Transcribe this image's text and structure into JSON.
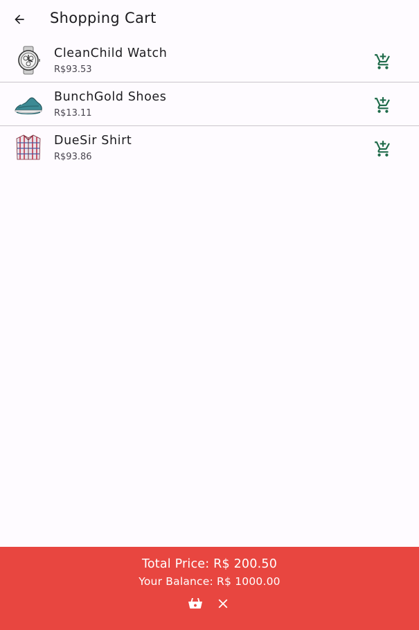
{
  "header": {
    "title": "Shopping Cart",
    "back_icon": "arrow-back-icon"
  },
  "cart": {
    "items": [
      {
        "name": "CleanChild Watch",
        "price": "R$93.53",
        "image": "watch-image",
        "action_icon": "add-shopping-cart-icon"
      },
      {
        "name": "BunchGold Shoes",
        "price": "R$13.11",
        "image": "shoes-image",
        "action_icon": "add-shopping-cart-icon"
      },
      {
        "name": "DueSir Shirt",
        "price": "R$93.86",
        "image": "shirt-image",
        "action_icon": "add-shopping-cart-icon"
      }
    ]
  },
  "footer": {
    "total_label": "Total Price: R$ 200.50",
    "balance_label": "Your Balance: R$ 1000.00",
    "buy_icon": "shopping-basket-icon",
    "clear_icon": "close-icon"
  },
  "colors": {
    "background": "#fefbff",
    "footer": "#e84640",
    "accent_icon": "#1f6b4a",
    "divider": "#c9c5ca"
  }
}
